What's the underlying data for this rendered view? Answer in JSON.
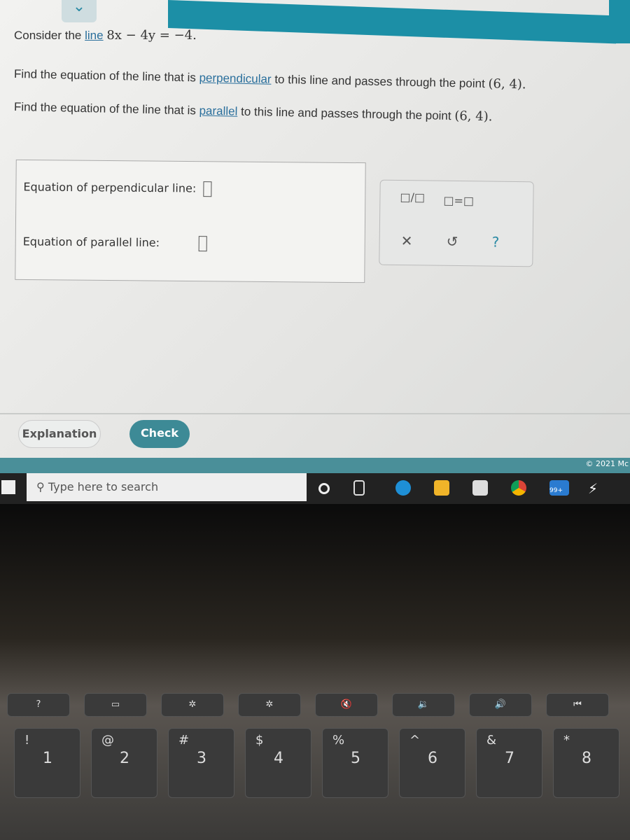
{
  "question": {
    "line_intro": "Consider the",
    "line_link": "line",
    "line_eq": "8x − 4y = −4.",
    "perp_prefix": "Find the equation of the line that is",
    "perp_link": "perpendicular",
    "perp_suffix": "to this line and passes through the point",
    "point": "(6, 4).",
    "par_prefix": "Find the equation of the line that is",
    "par_link": "parallel",
    "par_suffix": "to this line and passes through the point"
  },
  "answers": {
    "perpendicular_label": "Equation of perpendicular line:",
    "perpendicular_value": "",
    "parallel_label": "Equation of parallel line:",
    "parallel_value": ""
  },
  "toolbox": {
    "fraction": "□/□",
    "equation": "□=□",
    "clear": "✕",
    "undo": "↺",
    "help": "?"
  },
  "buttons": {
    "explanation": "Explanation",
    "check": "Check"
  },
  "footer": {
    "copyright": "© 2021 Mc"
  },
  "taskbar": {
    "search_placeholder": "Type here to search",
    "mail_badge": "99+"
  },
  "keyboard": {
    "keys": [
      {
        "main": "1",
        "shift": "!"
      },
      {
        "main": "2",
        "shift": "@"
      },
      {
        "main": "3",
        "shift": "#"
      },
      {
        "main": "4",
        "shift": "$"
      },
      {
        "main": "5",
        "shift": "%"
      },
      {
        "main": "6",
        "shift": "^"
      },
      {
        "main": "7",
        "shift": "&"
      },
      {
        "main": "8",
        "shift": "*"
      }
    ],
    "fkeys": [
      "?",
      "▭",
      "✲",
      "✲",
      "🔇",
      "🔉",
      "🔊",
      "⏮"
    ]
  },
  "colors": {
    "accent": "#1c8fa6",
    "check": "#3d8a96",
    "link": "#2a6f9c"
  }
}
